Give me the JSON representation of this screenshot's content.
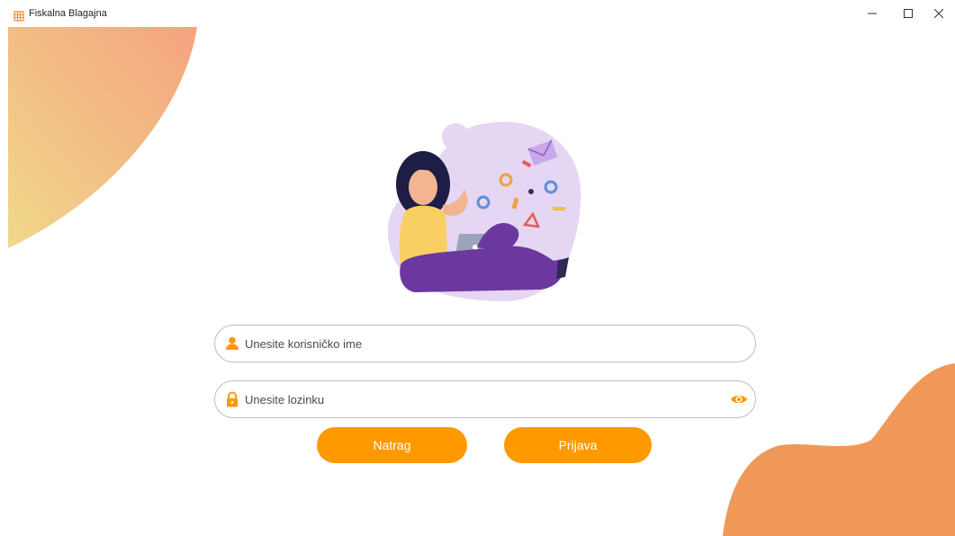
{
  "window": {
    "title": "Fiskalna Blagajna",
    "controls": [
      "minimize",
      "maximize",
      "close"
    ]
  },
  "login": {
    "username_placeholder": "Unesite korisničko ime",
    "username_value": "",
    "password_placeholder": "Unesite lozinku",
    "password_value": "",
    "back_label": "Natrag",
    "login_label": "Prijava"
  },
  "icons": {
    "user": "user-icon",
    "lock": "lock-icon",
    "eye": "eye-icon"
  },
  "colors": {
    "accent": "#FF9900",
    "illustration_purple": "#6B38A0",
    "blob_orange": "#F09858",
    "blob_gradient_start": "#F5A37F",
    "blob_gradient_end": "#F0D88A"
  }
}
